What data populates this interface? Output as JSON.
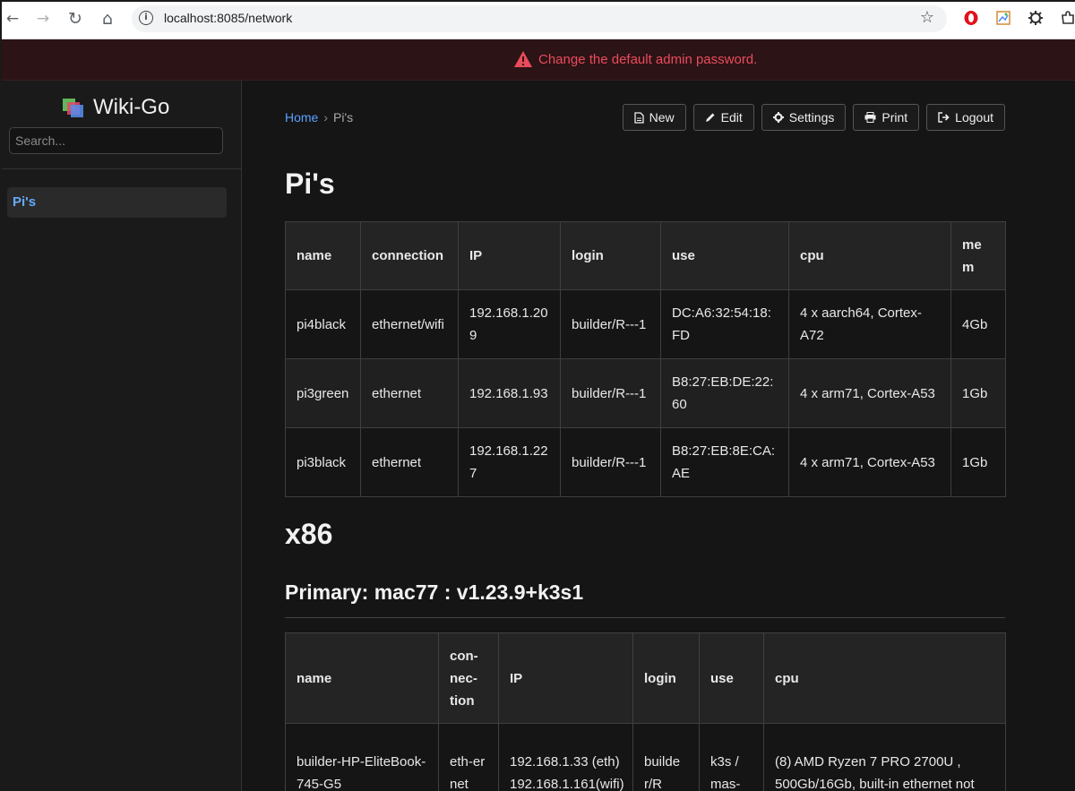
{
  "browser": {
    "url": "localhost:8085/network",
    "back": "←",
    "forward": "→",
    "reload": "↻",
    "home": "⌂",
    "star": "☆"
  },
  "alert": {
    "text": "Change the default admin password.",
    "icon": "warning-triangle-icon",
    "color": "#ea4b5b"
  },
  "sidebar": {
    "brand": "Wiki-Go",
    "search_placeholder": "Search...",
    "items": [
      {
        "label": "Pi's",
        "active": true
      }
    ]
  },
  "breadcrumb": {
    "home": "Home",
    "separator": "›",
    "current": "Pi's"
  },
  "toolbar": {
    "new": "New",
    "edit": "Edit",
    "settings": "Settings",
    "print": "Print",
    "logout": "Logout"
  },
  "page": {
    "title": "Pi's",
    "section": "x86",
    "subsection": "Primary: mac77 : v1.23.9+k3s1"
  },
  "table1": {
    "headers": [
      "name",
      "connection",
      "IP",
      "login",
      "use",
      "cpu",
      "me\nm"
    ],
    "rows": [
      [
        "pi4black",
        "ethernet/wifi",
        "192.168.1.209",
        "builder/R---1",
        "DC:A6:32:54:18:FD",
        "4 x aarch64, Cortex-A72",
        "4Gb"
      ],
      [
        "pi3green",
        "ethernet",
        "192.168.1.93",
        "builder/R---1",
        "B8:27:EB:DE:22:60",
        "4 x arm71, Cortex-A53",
        "1Gb"
      ],
      [
        "pi3black",
        "ethernet",
        "192.168.1.227",
        "builder/R---1",
        "B8:27:EB:8E:CA:AE",
        "4 x arm71, Cortex-A53",
        "1Gb"
      ]
    ]
  },
  "table2": {
    "headers": [
      "name",
      "con-\nnec-\ntion",
      "IP",
      "login",
      "use",
      "cpu"
    ],
    "rows": [
      [
        "builder-HP-EliteBook-745-G5",
        "eth-ernet",
        "192.168.1.33 (eth) 192.168.1.161(wifi)",
        "builder/R",
        "k3s / mas-",
        "(8) AMD Ryzen 7 PRO 2700U , 500Gb/16Gb, built-in ethernet not"
      ]
    ]
  },
  "colors": {
    "link": "#5aa1ff",
    "bg": "#151515",
    "alert_bg": "#2c1316"
  }
}
